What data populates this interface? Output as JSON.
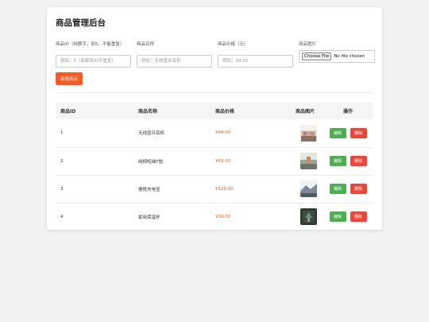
{
  "page": {
    "title": "商品管理后台"
  },
  "form": {
    "id_label": "商品ID（纯数字，如5，不能重复）",
    "id_placeholder": "例如：5（和现有ID不重复）",
    "name_label": "商品名称",
    "name_placeholder": "例如：无线蓝牙耳机",
    "price_label": "商品价格（元）",
    "price_placeholder": "例如：99.00",
    "image_label": "商品图片",
    "file_button": "Choose File",
    "file_status": "No file chosen",
    "add_button": "新增商品"
  },
  "table": {
    "headers": {
      "id": "商品ID",
      "name": "商品名称",
      "price": "商品价格",
      "image": "商品图片",
      "actions": "操作"
    },
    "edit_label": "编辑",
    "delete_label": "删除",
    "rows": [
      {
        "id": "1",
        "name": "无线蓝牙耳机",
        "price": "¥99.00",
        "image_icon": "product-photo"
      },
      {
        "id": "2",
        "name": "纯棉短袖T恤",
        "price": "¥59.00",
        "image_icon": "product-photo"
      },
      {
        "id": "3",
        "name": "便携充电宝",
        "price": "¥129.00",
        "image_icon": "product-photo"
      },
      {
        "id": "4",
        "name": "家用保温杯",
        "price": "¥39.00",
        "image_icon": "product-photo"
      }
    ]
  },
  "colors": {
    "accent": "#ff5722",
    "edit": "#4caf50",
    "delete": "#f44336"
  }
}
